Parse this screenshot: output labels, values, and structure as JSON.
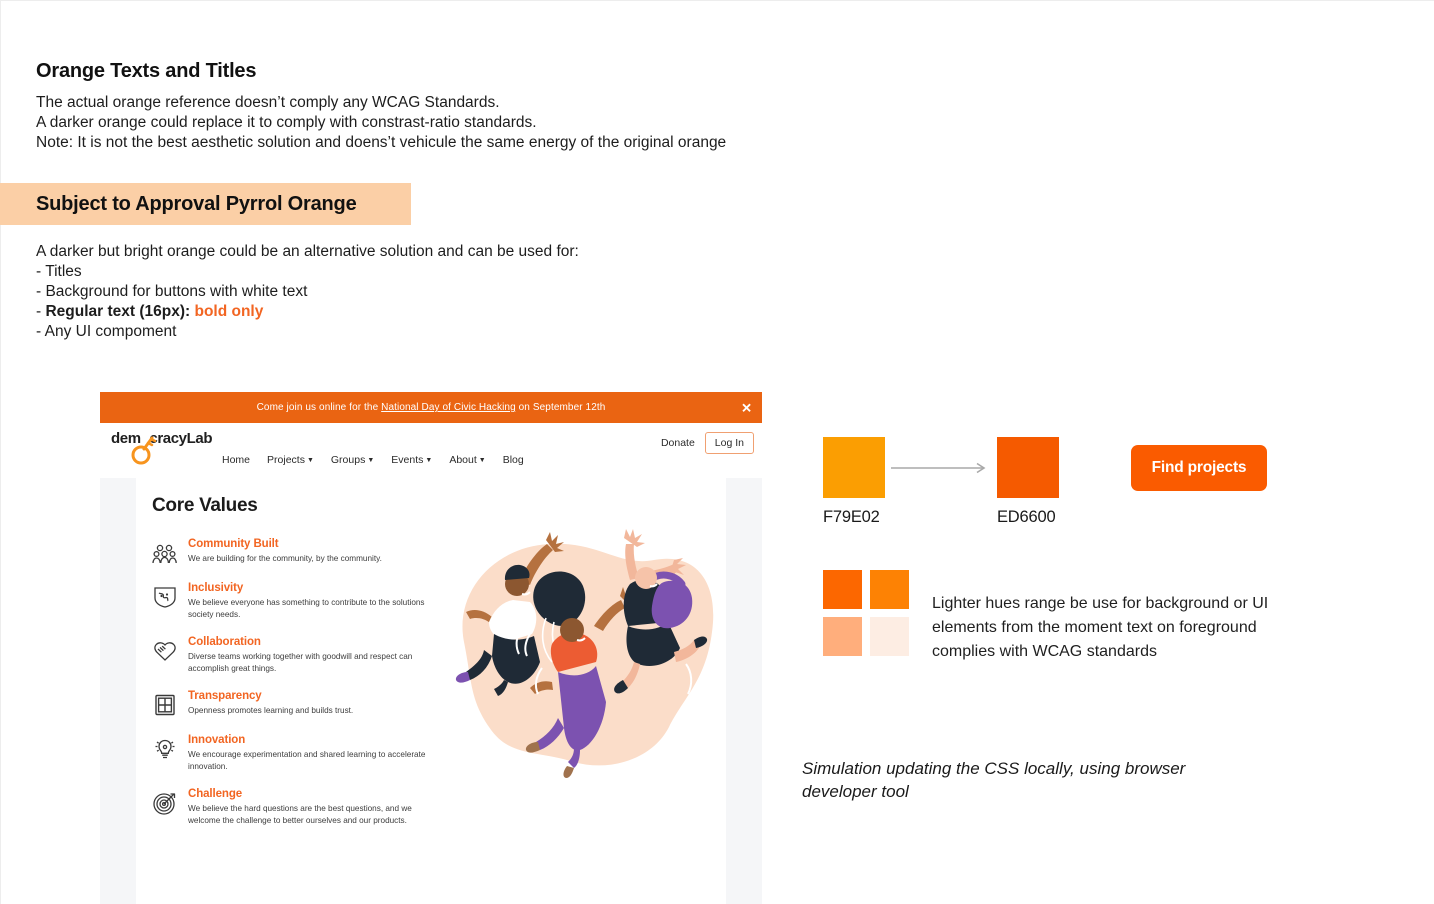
{
  "notes": {
    "heading": "Orange Texts and Titles",
    "lines": [
      "The actual orange reference doesn’t comply any WCAG Standards.",
      "A darker orange could replace it to comply with constrast-ratio standards.",
      "Note: It is not the best aesthetic solution and doens’t vehicule the same energy of the original orange"
    ]
  },
  "highlight": {
    "label": "Subject to Approval Pyrrol Orange",
    "background": "#FBCFA6"
  },
  "usage": {
    "intro": "A darker but bright orange could be an alternative solution and can be used for:",
    "items": [
      "- Titles",
      "- Background for buttons with white text"
    ],
    "regular_text_prefix": "- ",
    "regular_text_bold": "Regular text (16px):",
    "regular_text_accent": "bold only",
    "last_item": "- Any UI compoment",
    "accent_color": "#F26522"
  },
  "browser": {
    "banner": {
      "text_before": "Come join us online for the ",
      "link": "National Day of Civic Hacking",
      "text_after": " on September 12th",
      "close_icon": "close-icon",
      "background": "#EA6412"
    },
    "logo": {
      "word_start": "dem",
      "word_end": "cracyLab"
    },
    "nav": [
      {
        "label": "Home",
        "has_caret": false
      },
      {
        "label": "Projects",
        "has_caret": true
      },
      {
        "label": "Groups",
        "has_caret": true
      },
      {
        "label": "Events",
        "has_caret": true
      },
      {
        "label": "About",
        "has_caret": true
      },
      {
        "label": "Blog",
        "has_caret": false
      }
    ],
    "donate_label": "Donate",
    "login_label": "Log In",
    "core_values": {
      "title": "Core Values",
      "items": [
        {
          "icon": "people-group-icon",
          "name": "Community Built",
          "desc": "We are building for the community, by the community."
        },
        {
          "icon": "globe-shield-icon",
          "name": "Inclusivity",
          "desc": "We believe everyone has something to contribute to the solutions society needs."
        },
        {
          "icon": "handshake-icon",
          "name": "Collaboration",
          "desc": "Diverse teams working together with goodwill and respect can accomplish great things."
        },
        {
          "icon": "window-icon",
          "name": "Transparency",
          "desc": "Openness promotes learning and builds trust."
        },
        {
          "icon": "lightbulb-icon",
          "name": "Innovation",
          "desc": "We encourage experimentation and shared learning to accelerate innovation."
        },
        {
          "icon": "target-arrow-icon",
          "name": "Challenge",
          "desc": "We believe the hard questions are the best questions, and we welcome the challenge to better ourselves and our products."
        }
      ],
      "name_color": "#F26522"
    }
  },
  "swatch_pair": {
    "from": {
      "hex_label": "F79E02",
      "color": "#FB9E02"
    },
    "to": {
      "hex_label": "ED6600",
      "color": "#F55A00"
    },
    "arrow_icon": "arrow-right-icon"
  },
  "find_button": {
    "label": "Find projects",
    "color": "#FA5B00"
  },
  "lighter_hues": {
    "swatches": [
      "#FC6700",
      "#FD8204",
      "#FFAE7C",
      "#FDEDE3"
    ],
    "description": "Lighter hues range be use for background or UI elements from the moment text on foreground complies with WCAG standards"
  },
  "caption": "Simulation updating the CSS locally, using browser developer tool"
}
